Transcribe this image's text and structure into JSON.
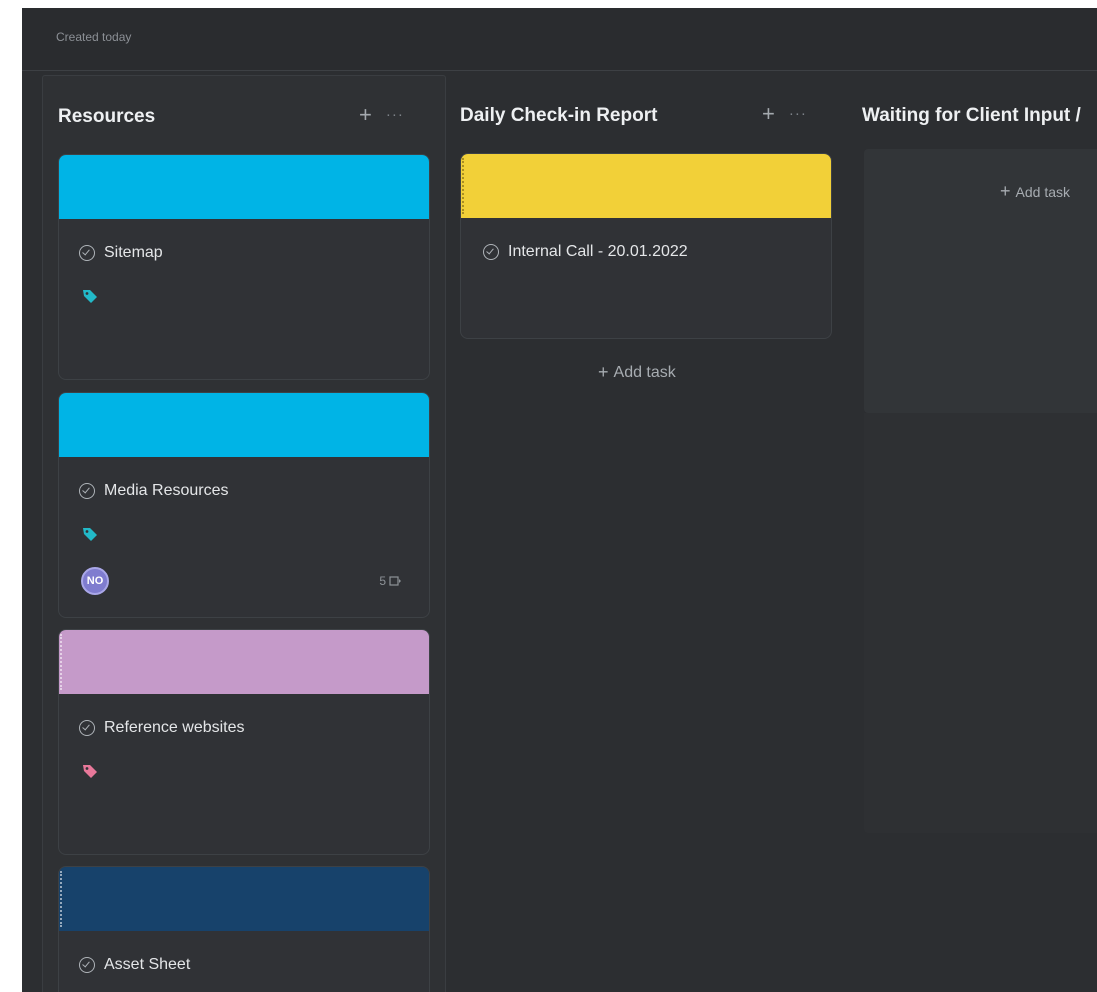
{
  "header": {
    "created_label": "Created today"
  },
  "columns": [
    {
      "title": "Resources",
      "cards": [
        {
          "title": "Sitemap",
          "cover_color": "#00b4e6",
          "tag_color": "#22b9c8"
        },
        {
          "title": "Media Resources",
          "cover_color": "#00b4e6",
          "tag_color": "#22b9c8",
          "assignee_initials": "NO",
          "subtasks": "5"
        },
        {
          "title": "Reference websites",
          "cover_color": "#c59ac9",
          "tag_color": "#e8789a"
        },
        {
          "title": "Asset Sheet",
          "cover_color": "#17426b"
        }
      ]
    },
    {
      "title": "Daily Check-in Report",
      "cards": [
        {
          "title": "Internal Call - 20.01.2022",
          "cover_color": "#f2d038"
        }
      ],
      "add_task_label": "Add task"
    },
    {
      "title": "Waiting for Client Input /",
      "add_task_label": "Add task"
    }
  ],
  "icons": {
    "add": "plus-icon",
    "more": "more-icon",
    "complete": "check-circle-icon",
    "label": "tag-icon",
    "subtasks": "subtask-icon"
  }
}
